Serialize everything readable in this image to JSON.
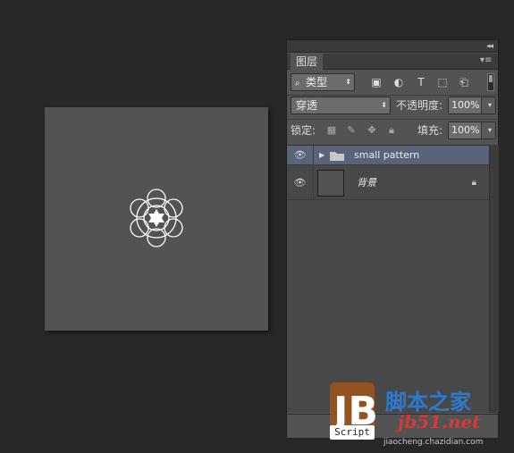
{
  "colors": {
    "background": "#282828",
    "canvas": "#535353",
    "panel": "#535353",
    "selected_layer": "#59647a"
  },
  "panel": {
    "tab_label": "图层",
    "collapse_icon": "double-chevron-icon",
    "menu_icon": "panel-menu-icon",
    "filter": {
      "kind_label": "类型",
      "icons": [
        "image-filter-icon",
        "adjustment-filter-icon",
        "type-filter-icon",
        "shape-filter-icon",
        "smart-object-filter-icon"
      ]
    },
    "blend_mode": "穿透",
    "opacity_label": "不透明度:",
    "opacity_value": "100%",
    "lock_label": "锁定:",
    "lock_icons": [
      "lock-transparent-icon",
      "lock-paint-icon",
      "lock-move-icon",
      "lock-all-icon"
    ],
    "fill_label": "填充:",
    "fill_value": "100%",
    "layers": [
      {
        "name": "small pattern",
        "type": "group",
        "visible": true,
        "selected": true
      },
      {
        "name": "背景",
        "type": "background",
        "visible": true,
        "locked": true,
        "selected": false
      }
    ]
  },
  "watermark": {
    "logo_text": "JB",
    "script_label": "Script",
    "site_name": "脚本之家",
    "site_code": "jb51.net",
    "url": "jiaocheng.chazidian.com"
  }
}
